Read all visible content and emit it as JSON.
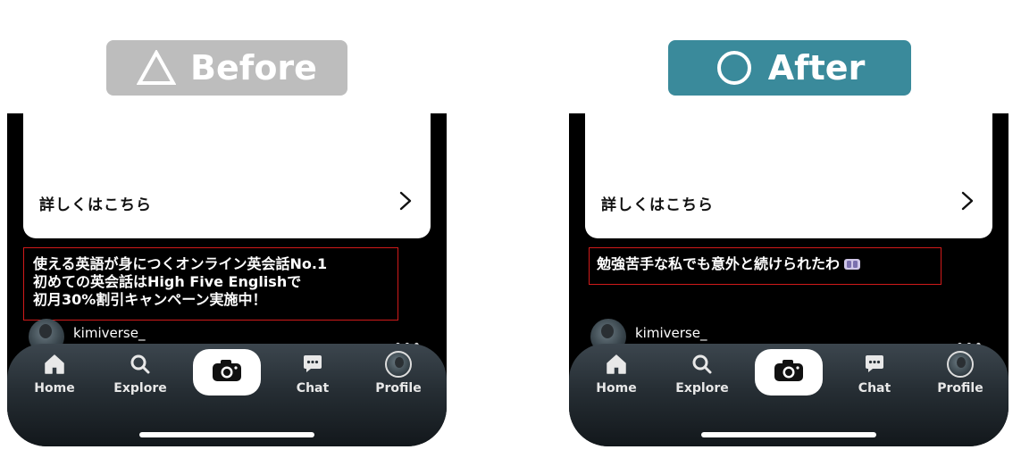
{
  "before": {
    "label": "Before",
    "symbol": "triangle-icon",
    "pill_color": "#bdbdbd",
    "card_link": "詳しくはこちら",
    "caption": "使える英語が身につくオンライン英会話No.1\n初めての英会話はHigh Five Englishで\n初月30%割引キャンペーン実施中！",
    "username": "kimiverse_"
  },
  "after": {
    "label": "After",
    "symbol": "circle-icon",
    "pill_color": "#3a8a9b",
    "card_link": "詳しくはこちら",
    "caption": "勉強苦手な私でも意外と続けられたわ",
    "caption_emoji": "crying-face-emoji",
    "username": "kimiverse_"
  },
  "nav": {
    "home": "Home",
    "explore": "Explore",
    "chat": "Chat",
    "profile": "Profile"
  },
  "more_dots": "•••",
  "colors": {
    "highlight_border": "#d01a1a",
    "phone_bg": "#000000"
  }
}
